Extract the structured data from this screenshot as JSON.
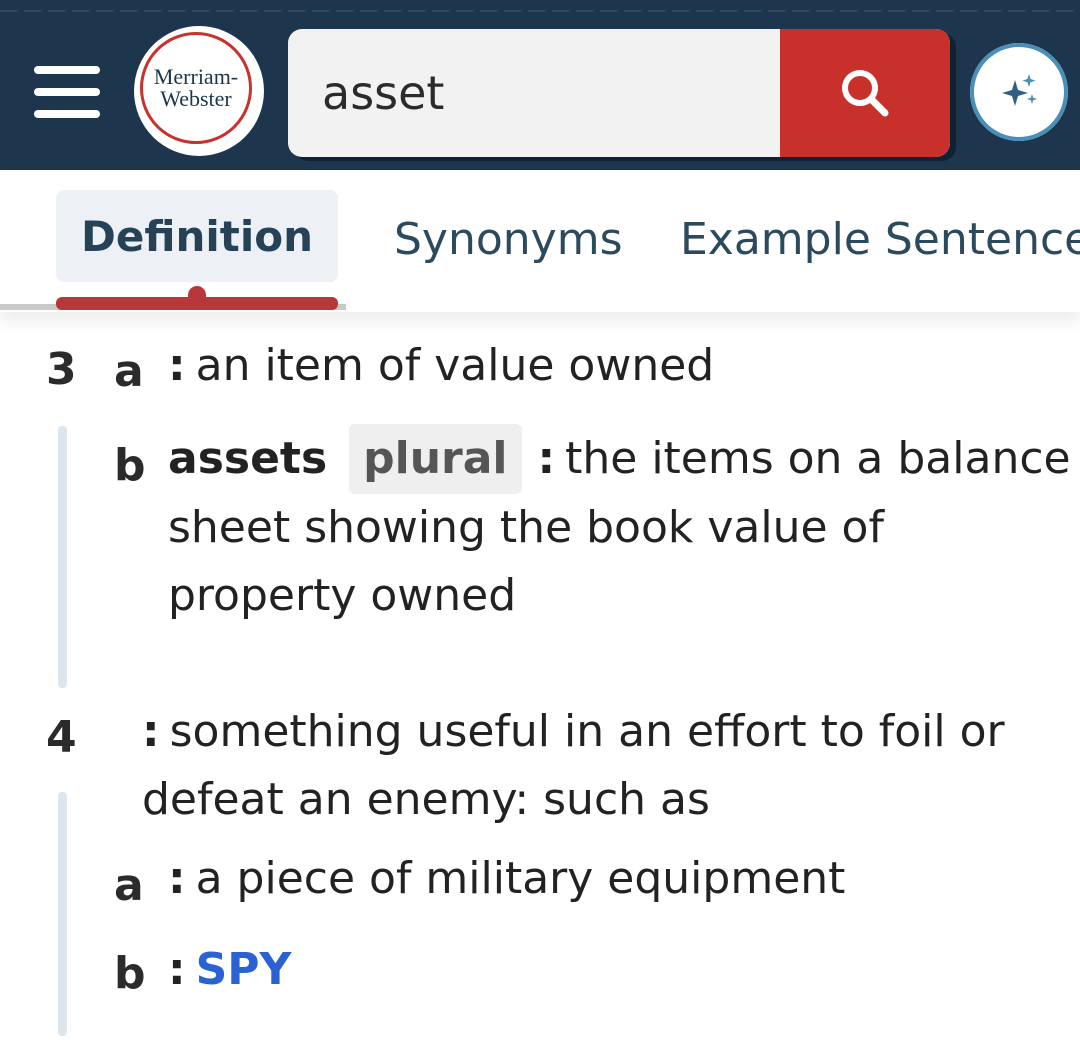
{
  "header": {
    "logo_line1": "Merriam-",
    "logo_line2": "Webster",
    "search_value": "asset"
  },
  "tabs": [
    {
      "label": "Definition",
      "active": true
    },
    {
      "label": "Synonyms",
      "active": false
    },
    {
      "label": "Example Sentences",
      "active": false
    }
  ],
  "senses": {
    "s3": {
      "number": "3",
      "a": {
        "letter": "a",
        "text": "an item of value owned"
      },
      "b": {
        "letter": "b",
        "headword": "assets",
        "label": "plural",
        "text_line1": "the items on a balance",
        "text_line2": "sheet showing the book value of",
        "text_line3": "property owned"
      }
    },
    "s4": {
      "number": "4",
      "text_line1": "something useful in an effort to foil or",
      "text_line2": "defeat an enemy: such as",
      "a": {
        "letter": "a",
        "text": "a piece of military equipment"
      },
      "b": {
        "letter": "b",
        "link": "SPY"
      }
    }
  },
  "colors": {
    "header_bg": "#1d364d",
    "search_button": "#c8312b",
    "tab_underline": "#b8373a",
    "link": "#2a62d4"
  }
}
